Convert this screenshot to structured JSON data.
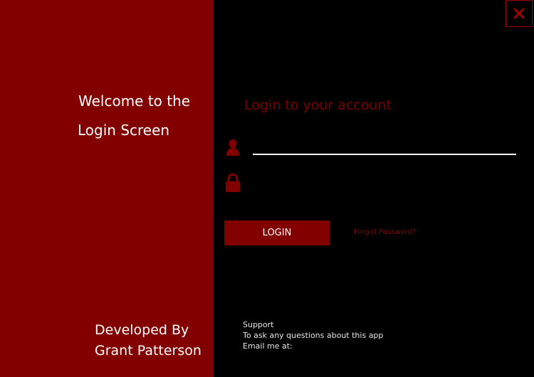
{
  "welcome": {
    "line1": "Welcome to the",
    "line2": "Login Screen"
  },
  "developer": {
    "line1": "Developed By",
    "line2": "Grant Patterson"
  },
  "window": {
    "close_label": "X"
  },
  "login": {
    "title": "Login to your account",
    "username_value": "",
    "password_value": "",
    "button_label": "LOGIN",
    "forgot_label": "Forgot Password?"
  },
  "support": {
    "line1": "Support",
    "line2": "To ask any questions about this app",
    "line3": "Email me at:"
  },
  "icons": {
    "user": "user-icon",
    "lock": "lock-icon",
    "close": "close-icon"
  },
  "colors": {
    "brand_red": "#820000",
    "title_red": "#7a0000",
    "background": "#000000"
  }
}
